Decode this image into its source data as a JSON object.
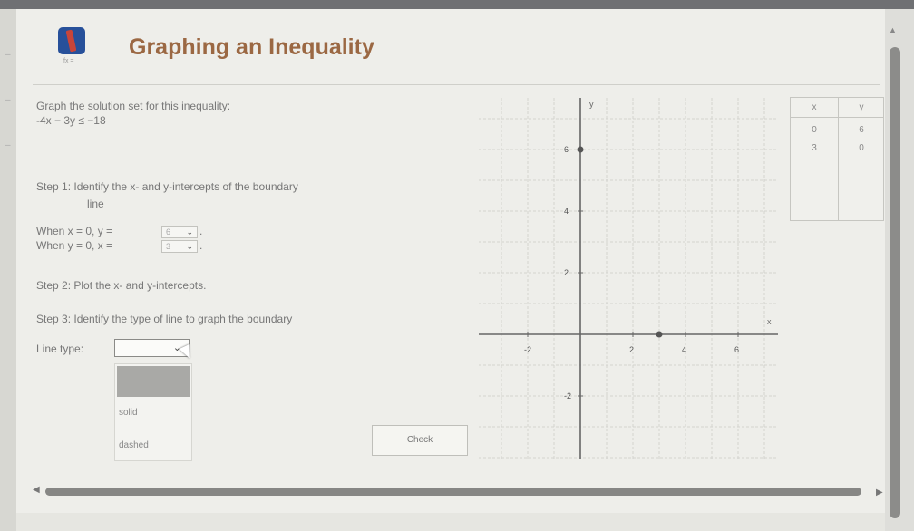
{
  "header": {
    "title": "Graphing an Inequality",
    "icon": "pencil-book-icon",
    "icon_caption": "fx ="
  },
  "problem": {
    "instruction": "Graph the solution set for this inequality:",
    "inequality": "-4x − 3y ≤ −18"
  },
  "step1": {
    "text_line1": "Step 1: Identify the x- and y-intercepts of the boundary",
    "text_line2": "line",
    "when_x_label": "When x = 0, y =",
    "when_x_value": "6",
    "when_y_label": "When y = 0, x =",
    "when_y_value": "3",
    "period": "."
  },
  "step2": {
    "text": "Step 2: Plot the x- and y-intercepts."
  },
  "step3": {
    "text": "Step 3: Identify the type of line to graph the boundary",
    "line_type_label": "Line type:",
    "line_type_value": "",
    "options": [
      "",
      "solid",
      "dashed"
    ]
  },
  "check_button": "Check",
  "table": {
    "headers": [
      "x",
      "y"
    ],
    "rows": [
      [
        "0",
        "6"
      ],
      [
        "3",
        "0"
      ]
    ]
  },
  "chart_data": {
    "type": "scatter",
    "xlabel": "x",
    "ylabel": "y",
    "xlim": [
      -3,
      7
    ],
    "ylim": [
      -3,
      7
    ],
    "x_ticks": [
      "-2",
      "2",
      "4",
      "6"
    ],
    "y_ticks": [
      "6",
      "4",
      "2",
      "-2"
    ],
    "grid": true,
    "points": [
      {
        "x": 0,
        "y": 6
      },
      {
        "x": 3,
        "y": 0
      }
    ],
    "accent_color": "#555555"
  },
  "colors": {
    "title": "#9b6843",
    "accent": "#27509a"
  }
}
